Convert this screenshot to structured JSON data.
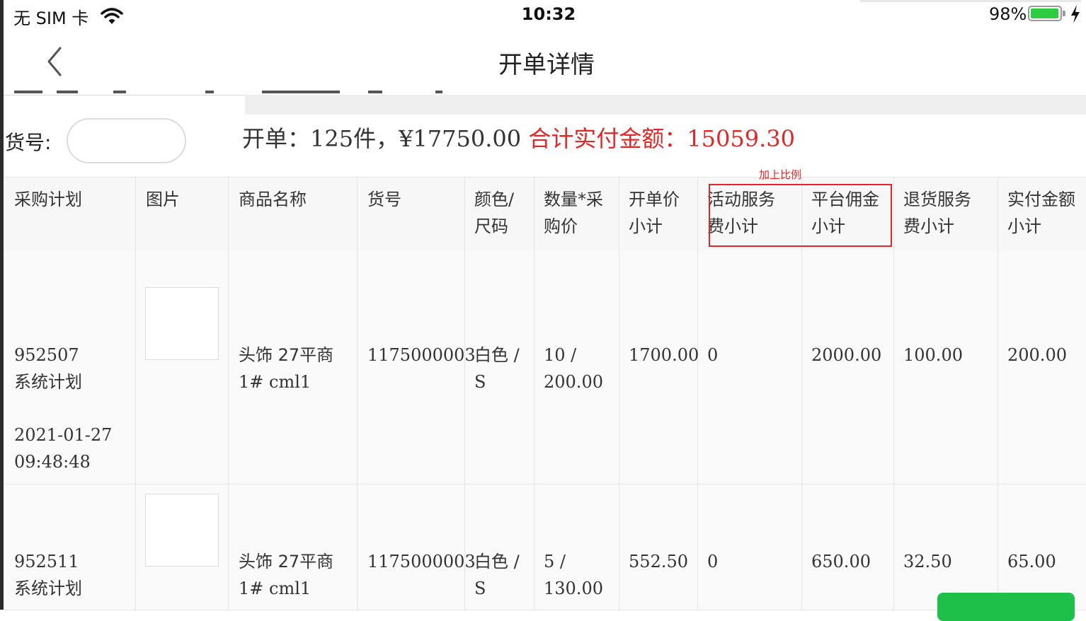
{
  "status_bar": {
    "carrier": "无 SIM 卡",
    "time": "10:32",
    "battery_percent": "98%",
    "battery_level": 0.98,
    "wifi_icon": "wifi-icon",
    "charging_icon": "charging-bolt-icon"
  },
  "nav": {
    "back_icon": "chevron-left-icon",
    "title": "开单详情"
  },
  "search": {
    "label": "货号:",
    "value": "",
    "placeholder": ""
  },
  "summary": {
    "prefix": "开单：125件，¥17750.00 ",
    "total_label": "合计实付金额：15059.30"
  },
  "annotation": {
    "text": "加上比例"
  },
  "colors": {
    "accent_red": "#e02828",
    "button_green": "#1fc04a",
    "header_bg": "#f7f7f7"
  },
  "table": {
    "headers": [
      [
        "采购计划"
      ],
      [
        "图片"
      ],
      [
        "商品名称"
      ],
      [
        "货号"
      ],
      [
        "颜色/",
        "尺码"
      ],
      [
        "数量*采",
        "购价"
      ],
      [
        "开单价",
        "小计"
      ],
      [
        "活动服务",
        "费小计"
      ],
      [
        "平台佣金",
        "小计"
      ],
      [
        "退货服务",
        "费小计"
      ],
      [
        "实付金额",
        "小计"
      ]
    ],
    "rows": [
      {
        "plan_id": "952507",
        "plan_type": "系统计划",
        "date": "2021-01-27",
        "time": "09:48:48",
        "name_line1": "头饰 27平商",
        "name_line2": "1# cml1",
        "sku": "1175000003",
        "color": "白色 /",
        "size": "S",
        "qty": "10 /",
        "price": "200.00",
        "order_subtotal": "1700.00",
        "activity_fee": "0",
        "platform_commission": "2000.00",
        "return_fee": "100.00",
        "paid_subtotal": "200.00"
      },
      {
        "plan_id": "952511",
        "plan_type": "系统计划",
        "name_line1": "头饰 27平商",
        "name_line2": "1# cml1",
        "sku": "1175000003",
        "color": "白色 /",
        "size": "S",
        "qty": "5 /",
        "price": "130.00",
        "order_subtotal": "552.50",
        "activity_fee": "0",
        "platform_commission": "650.00",
        "return_fee": "32.50",
        "paid_subtotal": "65.00"
      }
    ]
  }
}
